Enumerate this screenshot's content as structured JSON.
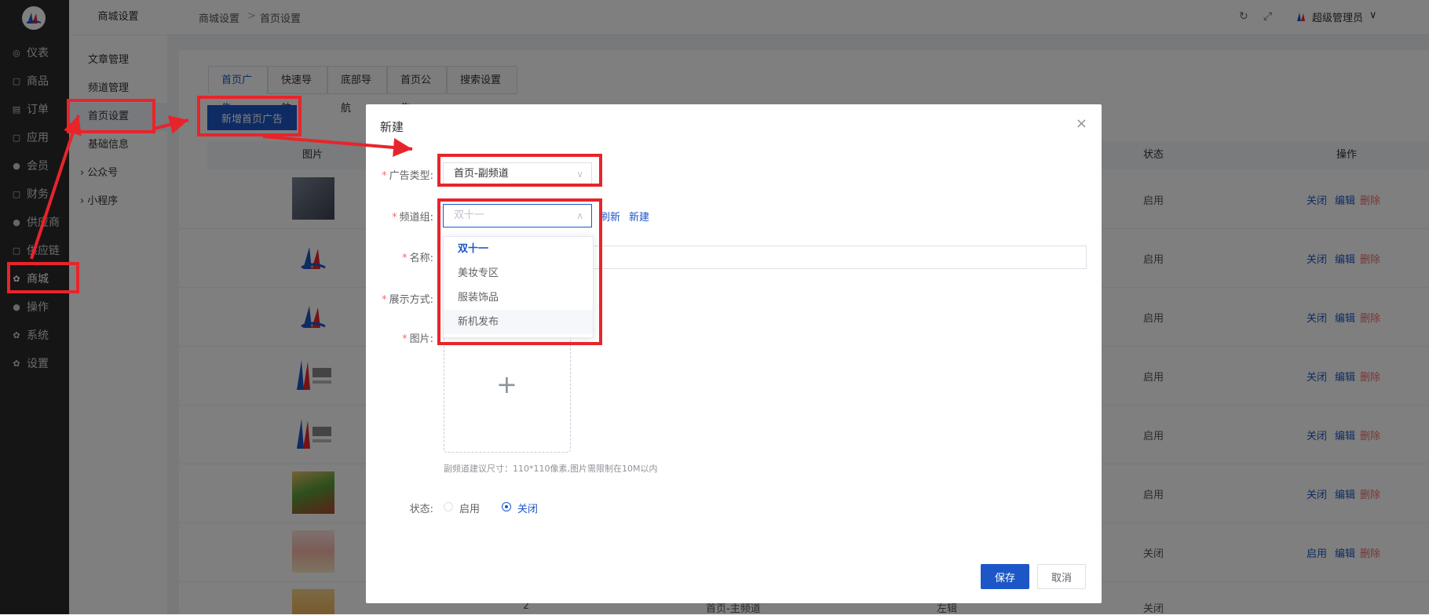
{
  "sidebar": {
    "items": [
      {
        "label": "仪表",
        "icon": "dashboard-icon",
        "glyph": "◎"
      },
      {
        "label": "商品",
        "icon": "bag-icon",
        "glyph": "▢"
      },
      {
        "label": "订单",
        "icon": "clipboard-icon",
        "glyph": "▤"
      },
      {
        "label": "应用",
        "icon": "bag-icon",
        "glyph": "▢"
      },
      {
        "label": "会员",
        "icon": "user-icon",
        "glyph": "●"
      },
      {
        "label": "财务",
        "icon": "bag-icon",
        "glyph": "▢"
      },
      {
        "label": "供应商",
        "icon": "user-icon",
        "glyph": "●"
      },
      {
        "label": "供应链",
        "icon": "bag-icon",
        "glyph": "▢"
      },
      {
        "label": "商城",
        "icon": "gear-icon",
        "glyph": "✿"
      },
      {
        "label": "操作",
        "icon": "user-icon",
        "glyph": "●"
      },
      {
        "label": "系统",
        "icon": "gear-icon",
        "glyph": "✿"
      },
      {
        "label": "设置",
        "icon": "gear-icon",
        "glyph": "✿"
      }
    ]
  },
  "submenu": {
    "title": "商城设置",
    "items": [
      "文章管理",
      "频道管理",
      "首页设置",
      "基础信息",
      "公众号",
      "小程序"
    ],
    "expand_glyph": "›"
  },
  "header": {
    "crumb1": "商城设置",
    "crumb_sep": ">",
    "crumb2": "首页设置",
    "refresh_glyph": "↻",
    "fullscreen_glyph": "⤢",
    "user": "超级管理员",
    "user_chevron": "∨"
  },
  "tabs": [
    "首页广告",
    "快速导航",
    "底部导航",
    "首页公告",
    "搜索设置"
  ],
  "add_button": "新增首页广告",
  "table": {
    "col_image": "图片",
    "col_status": "状态",
    "col_actions": "操作",
    "partial_row": {
      "num": "2",
      "type": "首页-主频道",
      "mode": "左辑",
      "status": "关闭"
    },
    "rows": [
      {
        "status": "启用",
        "toggle": "关闭",
        "edit": "编辑",
        "delete": "删除"
      },
      {
        "status": "启用",
        "toggle": "关闭",
        "edit": "编辑",
        "delete": "删除"
      },
      {
        "status": "启用",
        "toggle": "关闭",
        "edit": "编辑",
        "delete": "删除"
      },
      {
        "status": "启用",
        "toggle": "关闭",
        "edit": "编辑",
        "delete": "删除"
      },
      {
        "status": "启用",
        "toggle": "关闭",
        "edit": "编辑",
        "delete": "删除"
      },
      {
        "status": "启用",
        "toggle": "关闭",
        "edit": "编辑",
        "delete": "删除"
      },
      {
        "status": "关闭",
        "toggle": "启用",
        "edit": "编辑",
        "delete": "删除"
      }
    ]
  },
  "dialog": {
    "title": "新建",
    "close_glyph": "×",
    "ad_type_label": "广告类型:",
    "ad_type_value": "首页-副频道",
    "channel_label": "频道组:",
    "channel_placeholder": "双十一",
    "refresh_link": "刷新",
    "new_link": "新建",
    "name_label": "名称:",
    "display_label": "展示方式:",
    "image_label": "图片:",
    "upload_plus": "+",
    "image_hint": "副频道建议尺寸：110*110像素,图片需限制在10M以内",
    "status_label": "状态:",
    "status_on": "启用",
    "status_off": "关闭",
    "save": "保存",
    "cancel": "取消",
    "required_mark": "*",
    "chevron_down": "∨",
    "chevron_up": "∧",
    "dropdown": [
      "双十一",
      "美妆专区",
      "服装饰品",
      "新机发布"
    ]
  },
  "colors": {
    "accent": "#1d57c7",
    "annotation": "#e8242b",
    "danger": "#f56c6c"
  }
}
